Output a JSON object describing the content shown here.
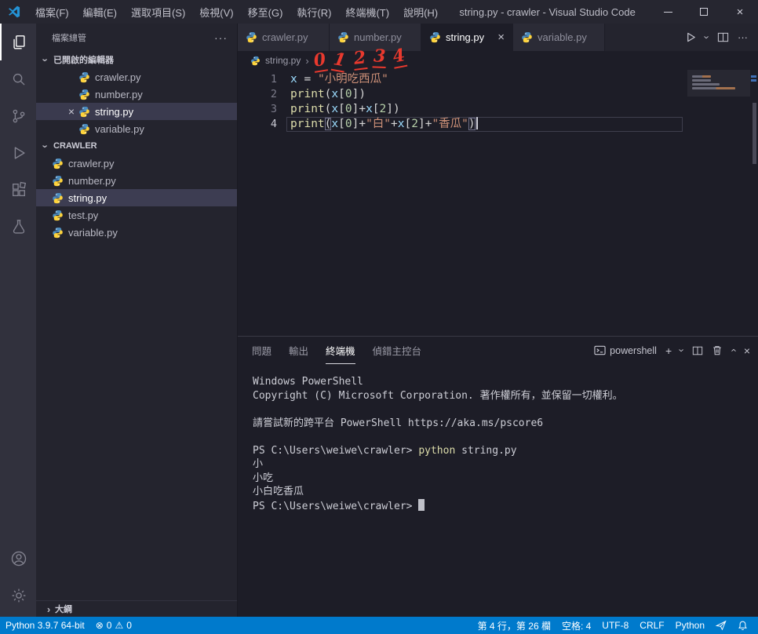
{
  "colors": {
    "status_bar": "#007acc",
    "annotation_red": "#e8392e",
    "python_icon_blue": "#4B8BBE",
    "python_icon_yellow": "#FFD43B",
    "string_orange": "#ce9178",
    "keyword_blue": "#9cdcfe",
    "function_yellow": "#dcdcaa"
  },
  "title_bar": {
    "menus": [
      "檔案(F)",
      "編輯(E)",
      "選取項目(S)",
      "檢視(V)",
      "移至(G)",
      "執行(R)",
      "終端機(T)",
      "說明(H)"
    ],
    "title": "string.py - crawler - Visual Studio Code",
    "window_controls": [
      "minimize",
      "maximize",
      "close"
    ]
  },
  "activity_bar": {
    "items": [
      "explorer",
      "search",
      "source-control",
      "run-debug",
      "extensions",
      "testing"
    ],
    "bottom_items": [
      "account",
      "settings"
    ]
  },
  "sidebar": {
    "header": "檔案總管",
    "more_actions": "···",
    "open_editors": {
      "label": "已開啟的編輯器",
      "items": [
        {
          "label": "crawler.py",
          "active": false
        },
        {
          "label": "number.py",
          "active": false
        },
        {
          "label": "string.py",
          "active": true
        },
        {
          "label": "variable.py",
          "active": false
        }
      ]
    },
    "project": {
      "label": "CRAWLER",
      "items": [
        {
          "label": "crawler.py",
          "selected": false
        },
        {
          "label": "number.py",
          "selected": false
        },
        {
          "label": "string.py",
          "selected": true
        },
        {
          "label": "test.py",
          "selected": false
        },
        {
          "label": "variable.py",
          "selected": false
        }
      ]
    },
    "outline_label": "大綱"
  },
  "editor": {
    "tabs": [
      {
        "label": "crawler.py",
        "active": false
      },
      {
        "label": "number.py",
        "active": false
      },
      {
        "label": "string.py",
        "active": true
      },
      {
        "label": "variable.py",
        "active": false
      }
    ],
    "breadcrumb": {
      "file": "string.py",
      "separator": "›"
    },
    "annotation": {
      "digits": [
        "0",
        "1",
        "2",
        "3",
        "4"
      ]
    },
    "lines": [
      {
        "num": "1",
        "tokens": [
          {
            "c": "var",
            "t": "x"
          },
          {
            "c": "op",
            "t": " = "
          },
          {
            "c": "str",
            "t": "\"小明吃西瓜\""
          }
        ]
      },
      {
        "num": "2",
        "tokens": [
          {
            "c": "fn",
            "t": "print"
          },
          {
            "c": "pn",
            "t": "("
          },
          {
            "c": "var",
            "t": "x"
          },
          {
            "c": "pn",
            "t": "["
          },
          {
            "c": "num",
            "t": "0"
          },
          {
            "c": "pn",
            "t": "]"
          },
          {
            "c": "pn",
            "t": ")"
          }
        ]
      },
      {
        "num": "3",
        "tokens": [
          {
            "c": "fn",
            "t": "print"
          },
          {
            "c": "pn",
            "t": "("
          },
          {
            "c": "var",
            "t": "x"
          },
          {
            "c": "pn",
            "t": "["
          },
          {
            "c": "num",
            "t": "0"
          },
          {
            "c": "pn",
            "t": "]"
          },
          {
            "c": "op",
            "t": "+"
          },
          {
            "c": "var",
            "t": "x"
          },
          {
            "c": "pn",
            "t": "["
          },
          {
            "c": "num",
            "t": "2"
          },
          {
            "c": "pn",
            "t": "]"
          },
          {
            "c": "pn",
            "t": ")"
          }
        ]
      },
      {
        "num": "4",
        "current": true,
        "cursor": true,
        "tokens": [
          {
            "c": "fn",
            "t": "print"
          },
          {
            "c": "mt",
            "t": "("
          },
          {
            "c": "var",
            "t": "x"
          },
          {
            "c": "pn",
            "t": "["
          },
          {
            "c": "num",
            "t": "0"
          },
          {
            "c": "pn",
            "t": "]"
          },
          {
            "c": "op",
            "t": "+"
          },
          {
            "c": "str",
            "t": "\"白\""
          },
          {
            "c": "op",
            "t": "+"
          },
          {
            "c": "var",
            "t": "x"
          },
          {
            "c": "pn",
            "t": "["
          },
          {
            "c": "num",
            "t": "2"
          },
          {
            "c": "pn",
            "t": "]"
          },
          {
            "c": "op",
            "t": "+"
          },
          {
            "c": "str",
            "t": "\"香瓜\""
          },
          {
            "c": "mt",
            "t": ")"
          }
        ]
      }
    ]
  },
  "panel": {
    "tabs": [
      "問題",
      "輸出",
      "終端機",
      "偵錯主控台"
    ],
    "active_tab": "終端機",
    "shell_label": "powershell",
    "terminal": {
      "lines": [
        {
          "tokens": [
            {
              "c": "t",
              "t": "Windows PowerShell"
            }
          ]
        },
        {
          "tokens": [
            {
              "c": "t",
              "t": "Copyright (C) Microsoft Corporation. 著作權所有，並保留一切權利。"
            }
          ]
        },
        {
          "tokens": []
        },
        {
          "tokens": [
            {
              "c": "t",
              "t": "請嘗試新的跨平台 PowerShell https://aka.ms/pscore6"
            }
          ]
        },
        {
          "tokens": []
        },
        {
          "tokens": [
            {
              "c": "t",
              "t": "PS C:\\Users\\weiwe\\crawler> "
            },
            {
              "c": "cmd",
              "t": "python"
            },
            {
              "c": "t",
              "t": " string.py"
            }
          ]
        },
        {
          "tokens": [
            {
              "c": "t",
              "t": "小"
            }
          ]
        },
        {
          "tokens": [
            {
              "c": "t",
              "t": "小吃"
            }
          ]
        },
        {
          "tokens": [
            {
              "c": "t",
              "t": "小白吃香瓜"
            }
          ]
        },
        {
          "tokens": [
            {
              "c": "t",
              "t": "PS C:\\Users\\weiwe\\crawler> "
            },
            {
              "c": "cursor",
              "t": ""
            }
          ]
        }
      ]
    }
  },
  "status_bar": {
    "left": [
      {
        "label": "Python 3.9.7 64-bit"
      },
      {
        "type": "problems",
        "error_glyph": "⊗",
        "errors": "0",
        "warning_glyph": "⚠",
        "warnings": "0"
      }
    ],
    "right": [
      {
        "label": "第 4 行，第 26 欄"
      },
      {
        "label": "空格: 4"
      },
      {
        "label": "UTF-8"
      },
      {
        "label": "CRLF"
      },
      {
        "label": "Python"
      },
      {
        "icon": "feedback"
      },
      {
        "icon": "bell"
      }
    ]
  }
}
